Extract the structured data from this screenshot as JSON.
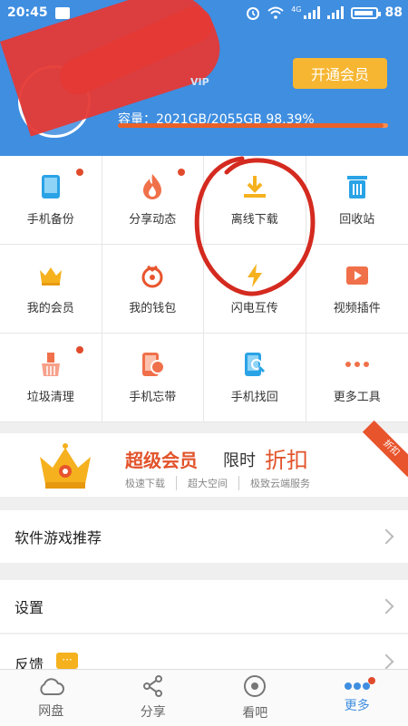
{
  "status_bar": {
    "time": "20:45",
    "network": "4G",
    "battery": "88"
  },
  "header": {
    "vip_badge": "VIP",
    "open_member_button": "开通会员",
    "storage_text": "容量：2021GB/2055GB 98.39%",
    "storage_used_fraction": 0.9839
  },
  "grid": [
    {
      "label": "手机备份",
      "icon": "phone-icon",
      "dot": true
    },
    {
      "label": "分享动态",
      "icon": "flame-icon",
      "dot": true
    },
    {
      "label": "离线下载",
      "icon": "download-icon",
      "dot": false
    },
    {
      "label": "回收站",
      "icon": "trash-icon",
      "dot": false
    },
    {
      "label": "我的会员",
      "icon": "crown-icon",
      "dot": false
    },
    {
      "label": "我的钱包",
      "icon": "wallet-icon",
      "dot": false
    },
    {
      "label": "闪电互传",
      "icon": "lightning-icon",
      "dot": false
    },
    {
      "label": "视频插件",
      "icon": "video-play-icon",
      "dot": false
    },
    {
      "label": "垃圾清理",
      "icon": "broom-icon",
      "dot": true
    },
    {
      "label": "手机忘带",
      "icon": "phone-cloud-icon",
      "dot": false
    },
    {
      "label": "手机找回",
      "icon": "phone-search-icon",
      "dot": false
    },
    {
      "label": "更多工具",
      "icon": "more-dots-icon",
      "dot": false
    }
  ],
  "promo": {
    "title_main": "超级会员",
    "title_limited": "限时",
    "title_discount": "折扣",
    "ribbon": "折扣",
    "features": [
      "极速下载",
      "超大空间",
      "极致云端服务"
    ]
  },
  "list": {
    "software_games": "软件游戏推荐",
    "settings": "设置",
    "feedback": "反馈",
    "feedback_badge": "···"
  },
  "tabs": [
    {
      "label": "网盘",
      "icon": "cloud-icon",
      "active": false
    },
    {
      "label": "分享",
      "icon": "share-icon",
      "active": false
    },
    {
      "label": "看吧",
      "icon": "eye-icon",
      "active": false
    },
    {
      "label": "更多",
      "icon": "more-dots-icon",
      "active": true
    }
  ],
  "colors": {
    "brand_blue": "#3f8ee0",
    "accent_orange": "#f6b632",
    "alert_red": "#e04b2c"
  }
}
